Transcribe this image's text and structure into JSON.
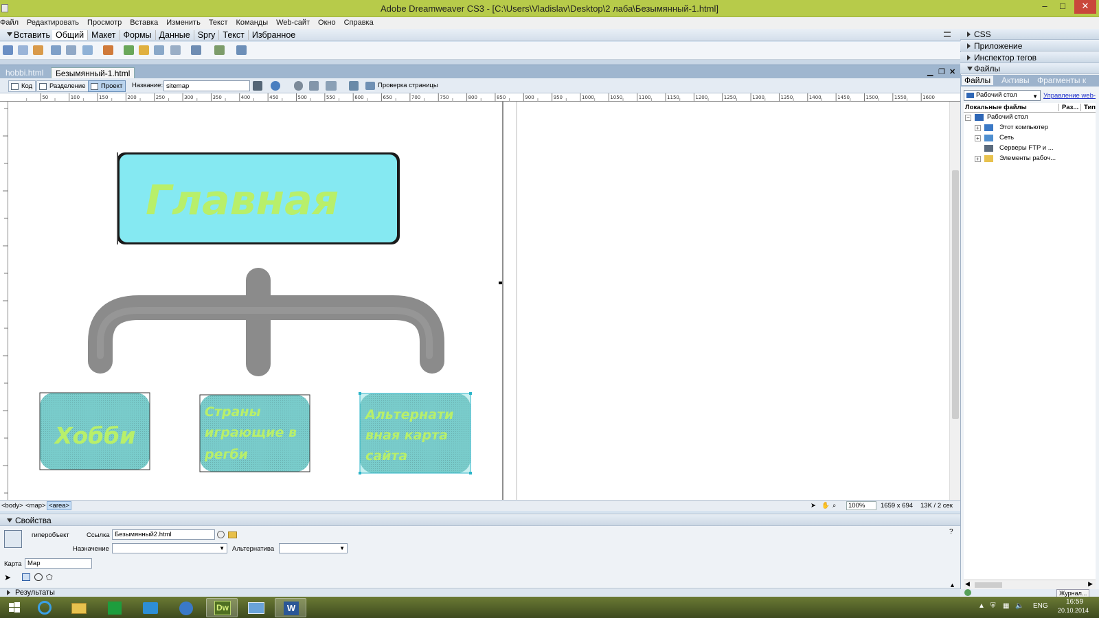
{
  "window": {
    "title": "Adobe Dreamweaver CS3 - [C:\\Users\\Vladislav\\Desktop\\2 лаба\\Безымянный-1.html]"
  },
  "menu": [
    "Файл",
    "Редактировать",
    "Просмотр",
    "Вставка",
    "Изменить",
    "Текст",
    "Команды",
    "Web-сайт",
    "Окно",
    "Справка"
  ],
  "insert_bar": {
    "label": "Вставить",
    "tabs": [
      "Общий",
      "Макет",
      "Формы",
      "Данные",
      "Spry",
      "Текст",
      "Избранное"
    ],
    "active_tab": "Общий"
  },
  "doc_tabs": [
    "hobbi.html",
    "Безымянный-1.html"
  ],
  "doc_toolbar": {
    "code": "Код",
    "split": "Разделение",
    "design": "Проект",
    "title_label": "Название:",
    "title_value": "sitemap",
    "check_page": "Проверка страницы"
  },
  "ruler_marks": [
    "50",
    "100",
    "150",
    "200",
    "250",
    "300",
    "350",
    "400",
    "450",
    "500",
    "550",
    "600",
    "650",
    "700",
    "750",
    "800",
    "850",
    "900",
    "950",
    "1000",
    "1050",
    "1100",
    "1150",
    "1200",
    "1250",
    "1300",
    "1350",
    "1400",
    "1450",
    "1500",
    "1550",
    "1600"
  ],
  "canvas": {
    "main_box": "Главная",
    "boxes": [
      "Хобби",
      "Страны играющие в регби",
      "Альтернативная карта сайта"
    ],
    "colors": {
      "main_fill": "#85e9f2",
      "sub_fill": "#79cccb",
      "text": "#b8ef6a",
      "connector": "#8b8b8b"
    }
  },
  "status": {
    "tags": [
      "<body>",
      "<map>",
      "<area>"
    ],
    "zoom": "100%",
    "size": "1659 x 694",
    "weight": "13K / 2 сек"
  },
  "properties": {
    "header": "Свойства",
    "type": "гиперобъект",
    "link_label": "Ссылка",
    "link_value": "Безымянный2.html",
    "target_label": "Назначение",
    "alt_label": "Альтернатива",
    "map_label": "Карта",
    "map_value": "Map",
    "results": "Результаты"
  },
  "panels": {
    "css": "CSS",
    "app": "Приложение",
    "tag_inspector": "Инспектор тегов",
    "files": "Файлы",
    "files_tabs": [
      "Файлы",
      "Активы",
      "Фрагменты к"
    ],
    "site": "Рабочий стол",
    "manage": "Управление web-",
    "columns": [
      "Локальные файлы",
      "Раз...",
      "Тип"
    ],
    "tree": [
      "Рабочий стол",
      "Этот компьютер",
      "Сеть",
      "Серверы FTP и ...",
      "Элементы рабоч..."
    ],
    "journal": "Журнал..."
  },
  "taskbar": {
    "lang": "ENG",
    "time": "16:59",
    "date": "20.10.2014",
    "dw_label": "Dw"
  }
}
